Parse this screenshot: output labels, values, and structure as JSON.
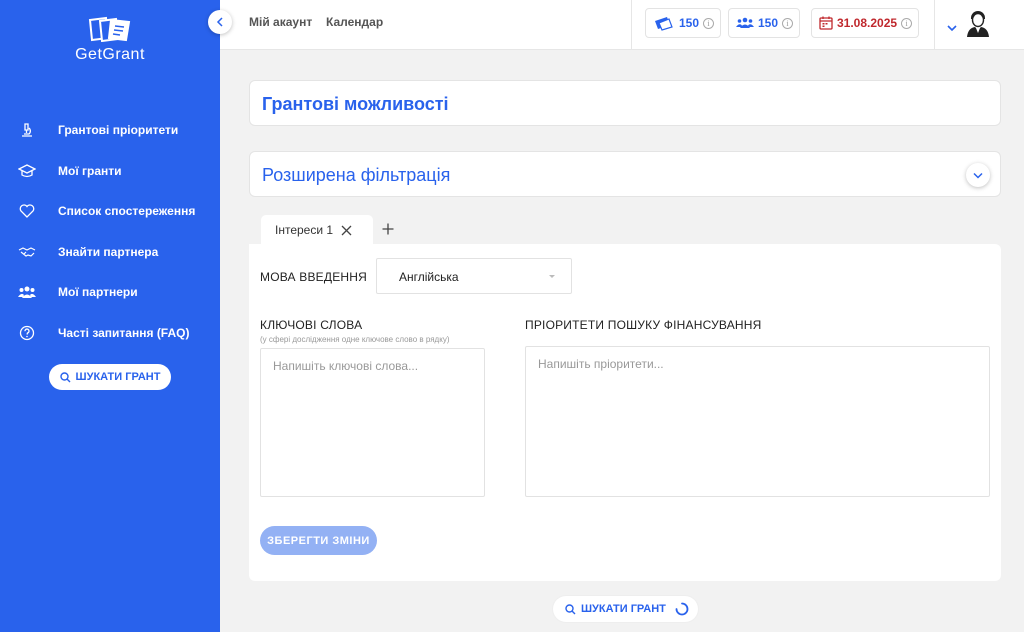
{
  "brand": {
    "name": "GetGrant",
    "accent": "#2962ec"
  },
  "sidebar": {
    "items": [
      {
        "label": "Грантові пріоритети",
        "icon": "microscope-icon"
      },
      {
        "label": "Мої гранти",
        "icon": "graduation-cap-icon"
      },
      {
        "label": "Список спостереження",
        "icon": "heart-icon"
      },
      {
        "label": "Знайти партнера",
        "icon": "handshake-icon"
      },
      {
        "label": "Мої партнери",
        "icon": "users-icon"
      },
      {
        "label": "Часті запитання (FAQ)",
        "icon": "question-icon"
      }
    ],
    "search_button": "ШУКАТИ ГРАНТ"
  },
  "topbar": {
    "links": [
      "Мій акаунт",
      "Календар"
    ],
    "credits": "150",
    "partners_count": "150",
    "date": "31.08.2025",
    "date_color": "#c0282d"
  },
  "main": {
    "page_title": "Грантові можливості",
    "filter_title": "Розширена фільтрація",
    "tab_label": "Інтереси 1",
    "language_label": "МОВА ВВЕДЕННЯ",
    "language_value": "Англійська",
    "keywords_label": "КЛЮЧОВІ СЛОВА",
    "keywords_hint": "(у сфері дослідження одне ключове слово в рядку)",
    "keywords_placeholder": "Напишіть ключові слова...",
    "priorities_label": "ПРІОРИТЕТИ ПОШУКУ ФІНАНСУВАННЯ",
    "priorities_placeholder": "Напишіть пріоритети...",
    "save_button": "ЗБЕРЕГТИ ЗМІНИ",
    "search_button": "ШУКАТИ ГРАНТ"
  }
}
